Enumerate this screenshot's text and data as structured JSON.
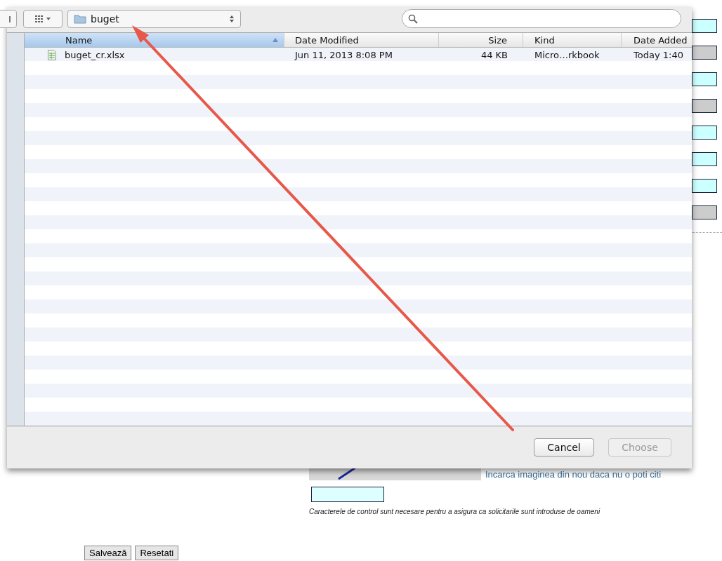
{
  "page": {
    "side_fields": [
      {
        "disabled": false
      },
      {
        "disabled": true
      },
      {
        "disabled": false
      },
      {
        "disabled": true
      },
      {
        "disabled": false
      },
      {
        "disabled": false
      },
      {
        "disabled": false
      },
      {
        "disabled": true
      }
    ],
    "captcha": {
      "reload_link": "Incarca imaginea din nou daca nu o poti citi",
      "note": "Caracterele de control sunt necesare pentru a asigura ca solicitarile sunt introduse de oameni"
    },
    "buttons": [
      "Salvează",
      "Resetati"
    ]
  },
  "dialog": {
    "path": "buget",
    "columns": [
      {
        "label": "Name",
        "selected": true
      },
      {
        "label": "Date Modified",
        "selected": false
      },
      {
        "label": "Size",
        "selected": false
      },
      {
        "label": "Kind",
        "selected": false
      },
      {
        "label": "Date Added",
        "selected": false
      }
    ],
    "files": [
      {
        "name": "buget_cr.xlsx",
        "date_modified": "Jun 11, 2013 8:08 PM",
        "size": "44 KB",
        "kind": "Micro…rkbook",
        "date_added": "Today 1:40"
      }
    ],
    "buttons": [
      {
        "label": "Cancel",
        "disabled": false
      },
      {
        "label": "Choose",
        "disabled": true
      }
    ]
  }
}
